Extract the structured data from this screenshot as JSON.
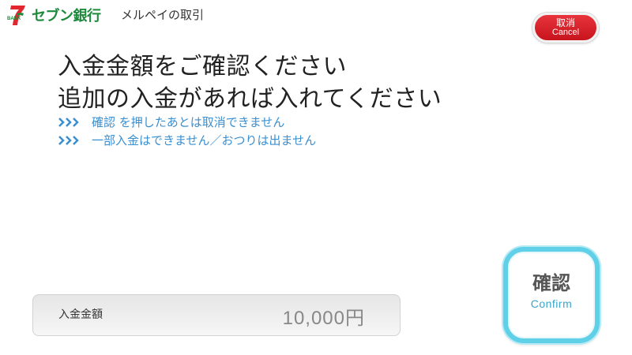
{
  "brand": {
    "logo_text": "7 BANK",
    "name": "セブン銀行"
  },
  "header": {
    "title": "メルペイの取引"
  },
  "cancel_button": {
    "label_jp": "取消",
    "label_en": "Cancel"
  },
  "main": {
    "heading_line1": "入金金額をご確認ください",
    "heading_line2": "追加の入金があれば入れてください",
    "notes": [
      "確認 を押したあとは取消できません",
      "一部入金はできません／おつりは出ません"
    ]
  },
  "amount": {
    "label": "入金金額",
    "value": "10,000円"
  },
  "confirm_button": {
    "label_jp": "確認",
    "label_en": "Confirm"
  },
  "colors": {
    "brand_green": "#1e8a3c",
    "brand_red": "#e3262e",
    "note_blue": "#3a8fd0",
    "cancel_red": "#d51f27",
    "confirm_border": "#5fd0e8"
  },
  "icons": {
    "logo": "seven-bank-logo-icon",
    "note_marker": "triple-chevron-right-icon"
  }
}
